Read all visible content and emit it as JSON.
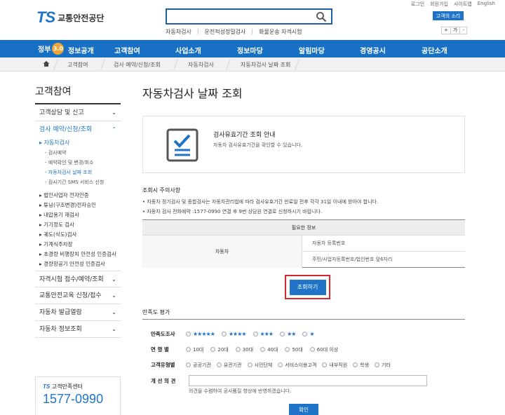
{
  "header": {
    "logo_mark": "TS",
    "logo_name": "교통안전공단",
    "search_placeholder": "",
    "quick_links": [
      "자동차검사",
      "운전적성정밀검사",
      "화물운송 자격시험"
    ],
    "util_links": [
      "로그인",
      "회원가입",
      "사이트맵",
      "English"
    ],
    "voice_button": "고객의 소리",
    "font_controls": [
      "+",
      "가",
      "-"
    ]
  },
  "gnb": {
    "gov_logo": "정부",
    "gov_badge": "3.0",
    "items": [
      "정보공개",
      "고객참여",
      "사업소개",
      "정보마당",
      "알림마당",
      "경영공시",
      "공단소개"
    ]
  },
  "breadcrumb": [
    "고객참여",
    "검사 예약/신청/조회",
    "자동차검사",
    "자동차검사 날짜 조회"
  ],
  "sidebar": {
    "title": "고객참여",
    "top_items": [
      "고객상담 및 신고",
      "검사 예약/신청/조회"
    ],
    "sub_active": "자동차검사",
    "sub_children": [
      "검사예약",
      "예약확인 및 변경/취소",
      "자동차검사 날짜 조회",
      "검사기간 SMS 서비스 신청"
    ],
    "sub_items": [
      "법인사업자 전자인증",
      "튜닝(구조변경)전자승인",
      "내압용기 재검사",
      "기기정도 검사",
      "궤도(삭도)검사",
      "기계식주차장",
      "초경량 비행장치 안전성 인증검사",
      "경량항공기 안전성 인증검사"
    ],
    "bottom_items": [
      "자격시험 접수/예약/조회",
      "교통안전교육 신청/접수",
      "자동차 발급열람",
      "자동차 정보조회"
    ],
    "cs_label": "고객만족센터",
    "cs_mark": "TS",
    "cs_phone": "1577-0990"
  },
  "main": {
    "title": "자동차검사 날짜 조회",
    "info_heading": "검사유효기간 조회 안내",
    "info_desc": "자동차 검사유효기간을 확인할 수 있습니다.",
    "caution_title": "조회시 주의사항",
    "caution_items": [
      "• 자동차 정기검사 및 종합검사는 자동차관리법에 따라 검사유효기간 만료일 전후 각각 31일 이내에 받아야 합니다.",
      "• 자동차 검사 전화예약 :1577-0990 연결 후 9번 상담원 연결로 신청하시기 바랍니다."
    ],
    "table_header": "필요한 정보",
    "table_category": "자동차",
    "table_values": [
      "자동차 등록번호",
      "주민/사업자등록번호/법인번호 앞6자리"
    ],
    "lookup_button": "조회하기",
    "sat_title": "만족도 평가",
    "sat_label": "만족도조사",
    "sat_stars": [
      "★★★★★",
      "★★★★",
      "★★★",
      "★★",
      "★"
    ],
    "age_label": "연 령 별",
    "age_options": [
      "10대",
      "20대",
      "30대",
      "40대",
      "50대",
      "60대 이상"
    ],
    "type_label": "고객유형별",
    "type_options": [
      "공공기관",
      "유관기관",
      "시민단체",
      "서비스이용고객",
      "내부직원",
      "학생",
      "기타"
    ],
    "improve_label": "개 선 의 견",
    "improve_note": "의견을 수렴하여 공사품질 향상에 반영하겠습니다.",
    "confirm_button": "확인"
  }
}
